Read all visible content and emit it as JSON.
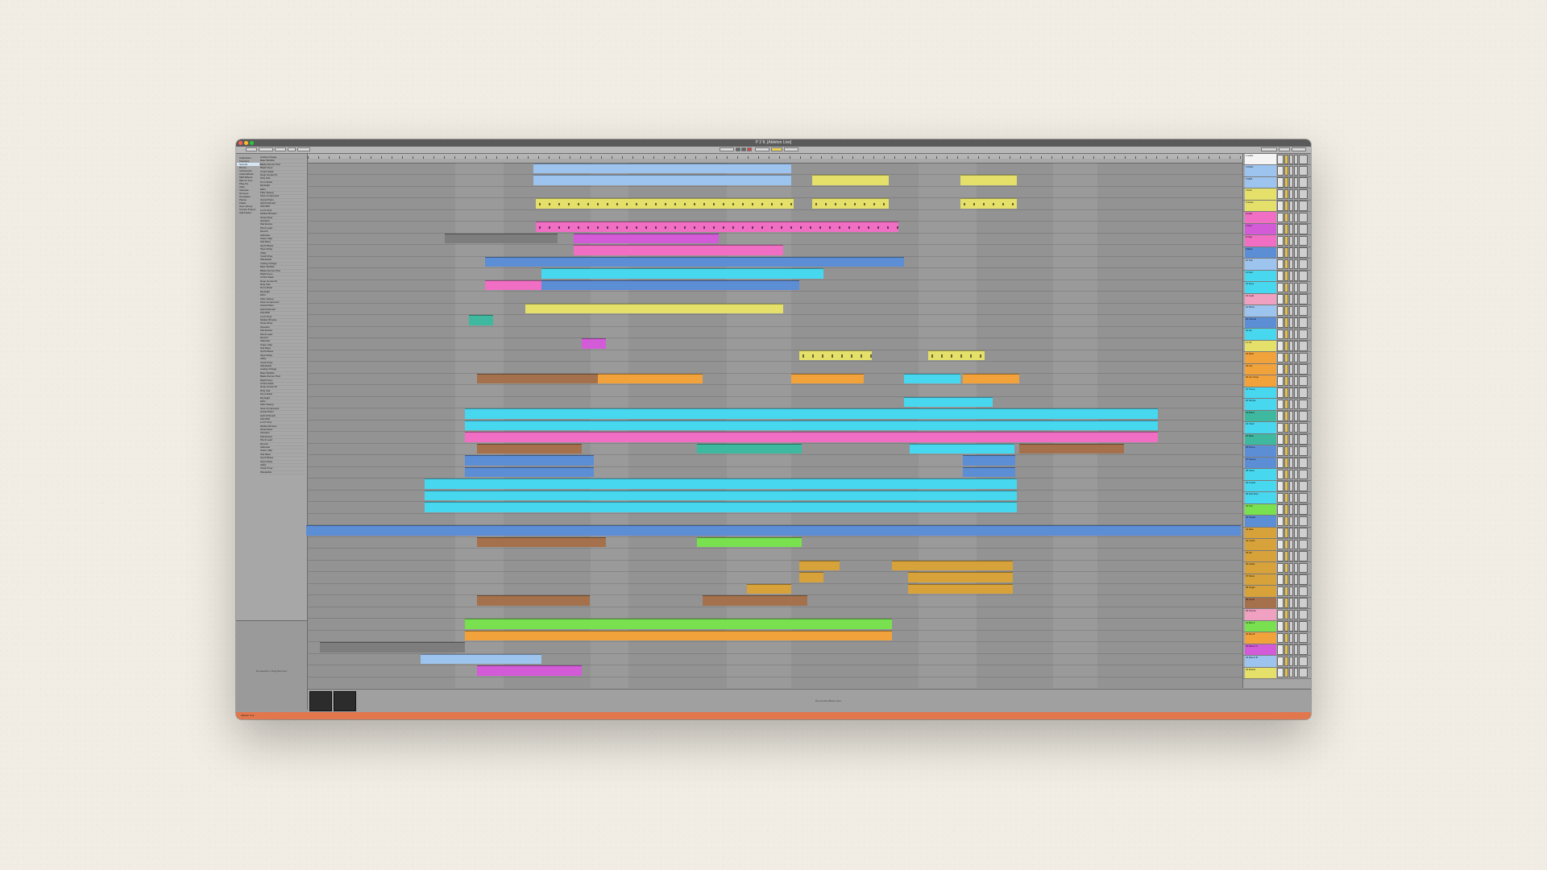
{
  "window": {
    "title": "P 2 ft. [Ableton Live]"
  },
  "browser": {
    "categories": [
      "Collections",
      "Favorites",
      "Sounds",
      "Drums",
      "Instruments",
      "Audio Effects",
      "MIDI Effects",
      "Max for Live",
      "Plug-Ins",
      "Clips",
      "Samples",
      "Grooves",
      "Templates",
      "Places",
      "Packs",
      "User Library",
      "Current Project",
      "Add Folder..."
    ],
    "items": [
      "Analog Vintage",
      "Bass Wobble",
      "Blade Runner Pad",
      "Bright Keys",
      "Chord Stack",
      "Deep House Kit",
      "Dirty Sub",
      "Drum Rack",
      "EQ Eight",
      "Echo",
      "Filter Sweep",
      "Glue Compressor",
      "Grand Piano",
      "Hybrid Reverb",
      "Kick 808",
      "Lo-Fi Vinyl",
      "Mellow Rhodes",
      "Noise Riser",
      "Operator",
      "Pad Evolve",
      "Pluck Lead",
      "Reverb",
      "Saturator",
      "Snare Clap",
      "Sub Bass",
      "Synth Brass",
      "Tape Delay",
      "Utility",
      "Vocal Chop",
      "Wavetable",
      "Analog Vintage",
      "Bass Wobble",
      "Blade Runner Pad",
      "Bright Keys",
      "Chord Stack",
      "Deep House Kit",
      "Dirty Sub",
      "Drum Rack",
      "EQ Eight",
      "Echo",
      "Filter Sweep",
      "Glue Compressor",
      "Grand Piano",
      "Hybrid Reverb",
      "Kick 808",
      "Lo-Fi Vinyl",
      "Mellow Rhodes",
      "Noise Riser",
      "Operator",
      "Pad Evolve",
      "Pluck Lead",
      "Reverb",
      "Saturator",
      "Snare Clap",
      "Sub Bass",
      "Synth Brass",
      "Tape Delay",
      "Utility",
      "Vocal Chop",
      "Wavetable",
      "Analog Vintage",
      "Bass Wobble",
      "Blade Runner Pad",
      "Bright Keys",
      "Chord Stack",
      "Deep House Kit",
      "Dirty Sub",
      "Drum Rack",
      "EQ Eight",
      "Echo",
      "Filter Sweep",
      "Glue Compressor",
      "Grand Piano",
      "Hybrid Reverb",
      "Kick 808",
      "Lo-Fi Vinyl",
      "Mellow Rhodes",
      "Noise Riser",
      "Operator",
      "Pad Evolve",
      "Pluck Lead",
      "Reverb",
      "Saturator",
      "Snare Clap",
      "Sub Bass",
      "Synth Brass",
      "Tape Delay",
      "Utility",
      "Vocal Chop",
      "Wavetable"
    ],
    "info_text": "No selection / Drag files here"
  },
  "detail": {
    "hint": "Drop Audio Effects Here"
  },
  "status": {
    "text": "Ableton Live"
  },
  "colors": {
    "cyan": "#47d8f0",
    "blue": "#5c8ed6",
    "yellow": "#e4e06a",
    "orange": "#f2a23a",
    "pink": "#f06fc4",
    "magenta": "#d35bd8",
    "brown": "#a5714c",
    "teal": "#3eb9a0",
    "green": "#79e050",
    "gold": "#d7a23a",
    "grey": "#7d7d7d",
    "red": "#e2443d",
    "lightblue": "#9dc4ee",
    "status": "#e2774d"
  },
  "tracks": [
    {
      "name": "1 Audio",
      "color": "#f4f4f4"
    },
    {
      "name": "2 Audio",
      "color": "#9dc4ee"
    },
    {
      "name": "3 MIDI",
      "color": "#9dc4ee"
    },
    {
      "name": "4 Kick",
      "color": "#e4e06a"
    },
    {
      "name": "5 Snare",
      "color": "#e4e06a"
    },
    {
      "name": "6 Hats",
      "color": "#f06fc4"
    },
    {
      "name": "7 Perc",
      "color": "#d35bd8"
    },
    {
      "name": "8 Clap",
      "color": "#f06fc4"
    },
    {
      "name": "9 Bass",
      "color": "#5c8ed6"
    },
    {
      "name": "10 Sub",
      "color": "#9dc4ee"
    },
    {
      "name": "11 Pad",
      "color": "#47d8f0"
    },
    {
      "name": "12 Keys",
      "color": "#47d8f0"
    },
    {
      "name": "13 Lead",
      "color": "#f0a0c0"
    },
    {
      "name": "14 Pluck",
      "color": "#9dc4ee"
    },
    {
      "name": "15 Chords",
      "color": "#5c8ed6"
    },
    {
      "name": "16 Arp",
      "color": "#47d8f0"
    },
    {
      "name": "17 FX",
      "color": "#e4e06a"
    },
    {
      "name": "18 Riser",
      "color": "#f2a23a"
    },
    {
      "name": "19 Vox",
      "color": "#f2a23a"
    },
    {
      "name": "20 Vox Chop",
      "color": "#f2a23a"
    },
    {
      "name": "21 Group",
      "color": "#47d8f0"
    },
    {
      "name": "22 Strings",
      "color": "#47d8f0"
    },
    {
      "name": "23 Brass",
      "color": "#3eb9a0"
    },
    {
      "name": "24 Choir",
      "color": "#47d8f0"
    },
    {
      "name": "25 Bells",
      "color": "#3eb9a0"
    },
    {
      "name": "26 Drone",
      "color": "#5c8ed6"
    },
    {
      "name": "27 Sweep",
      "color": "#5c8ed6"
    },
    {
      "name": "28 Noise",
      "color": "#47d8f0"
    },
    {
      "name": "29 Impact",
      "color": "#47d8f0"
    },
    {
      "name": "30 Sub Drop",
      "color": "#47d8f0"
    },
    {
      "name": "31 Tom",
      "color": "#79e050"
    },
    {
      "name": "32 Shaker",
      "color": "#5c8ed6"
    },
    {
      "name": "33 Ride",
      "color": "#d7a23a"
    },
    {
      "name": "34 Crash",
      "color": "#d7a23a"
    },
    {
      "name": "35 Fill",
      "color": "#d7a23a"
    },
    {
      "name": "36 Guitar",
      "color": "#d7a23a"
    },
    {
      "name": "37 Piano",
      "color": "#d7a23a"
    },
    {
      "name": "38 Organ",
      "color": "#d7a23a"
    },
    {
      "name": "39 Synth",
      "color": "#a5714c"
    },
    {
      "name": "40 Texture",
      "color": "#f0a0c0"
    },
    {
      "name": "41 Bus A",
      "color": "#79e050"
    },
    {
      "name": "42 Bus B",
      "color": "#f2a23a"
    },
    {
      "name": "43 Return A",
      "color": "#d35bd8"
    },
    {
      "name": "44 Return B",
      "color": "#9dc4ee"
    },
    {
      "name": "45 Master",
      "color": "#e4e06a"
    }
  ]
}
